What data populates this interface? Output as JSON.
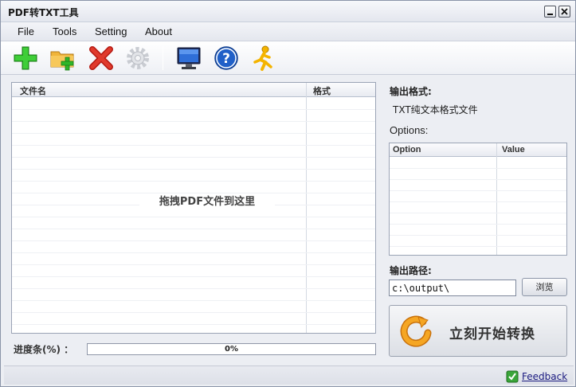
{
  "window": {
    "title": "PDF转TXT工具"
  },
  "menu": {
    "items": [
      "File",
      "Tools",
      "Setting",
      "About"
    ]
  },
  "toolbar": {
    "icons": [
      "add-file-icon",
      "add-folder-icon",
      "delete-icon",
      "settings-icon",
      "monitor-icon",
      "help-icon",
      "runner-icon"
    ]
  },
  "file_list": {
    "columns": [
      "文件名",
      "格式"
    ],
    "drop_hint": "拖拽PDF文件到这里"
  },
  "progress": {
    "label": "进度条(%) ：",
    "value": 0,
    "text": "0%"
  },
  "output": {
    "format_label": "输出格式:",
    "format_value": "TXT纯文本格式文件",
    "options_label": "Options:",
    "options_columns": [
      "Option",
      "Value"
    ],
    "path_label": "输出路径:",
    "path_value": "c:\\output\\",
    "browse_label": "浏览",
    "start_label": "立刻开始转换"
  },
  "status": {
    "feedback_label": "Feedback"
  },
  "colors": {
    "accent_green": "#2fb62a",
    "delete_red": "#d9261c",
    "help_blue": "#2060c8",
    "start_orange": "#f0a020"
  }
}
